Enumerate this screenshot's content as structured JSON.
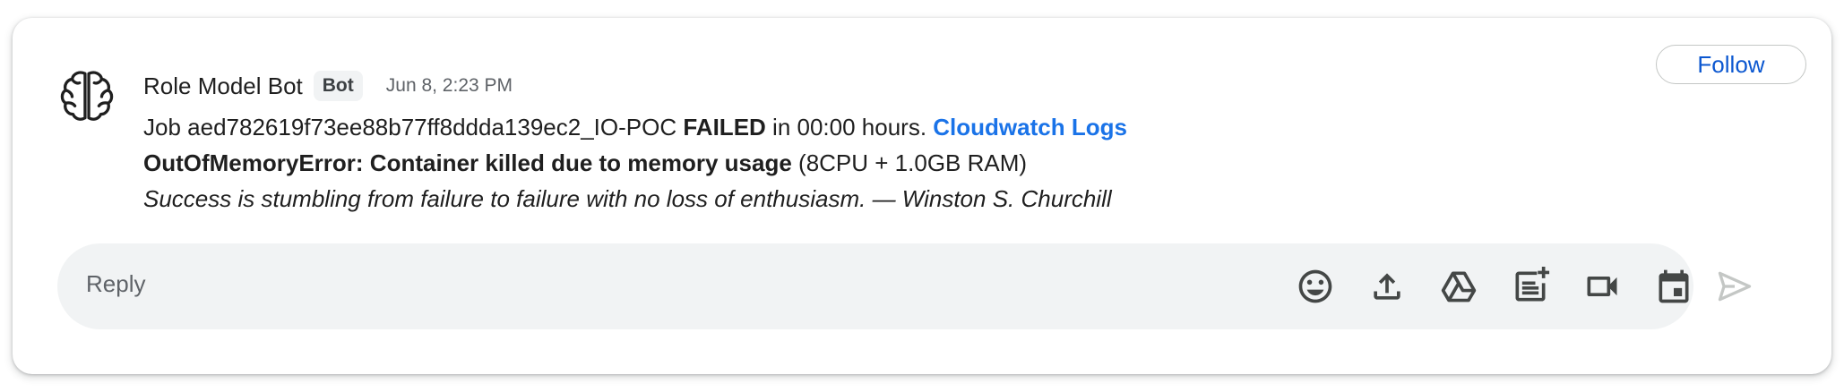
{
  "message": {
    "sender_name": "Role Model Bot",
    "badge": "Bot",
    "timestamp": "Jun 8, 2:23 PM",
    "follow_label": "Follow",
    "line1_prefix": "Job aed782619f73ee88b77ff8ddda139ec2_IO-POC ",
    "line1_status": "FAILED",
    "line1_suffix": " in 00:00 hours. ",
    "line1_link": "Cloudwatch Logs",
    "line2_error": "OutOfMemoryError: Container killed due to memory usage",
    "line2_resources": " (8CPU + 1.0GB RAM)",
    "quote": "Success is stumbling from failure to failure with no loss of enthusiasm. — Winston S. Churchill"
  },
  "reply": {
    "placeholder": "Reply",
    "tools": [
      "emoji-icon",
      "upload-icon",
      "drive-icon",
      "add-note-icon",
      "video-icon",
      "calendar-icon"
    ],
    "send_icon": "send-icon"
  },
  "colors": {
    "link": "#1a73e8",
    "follow": "#0b57d0",
    "reply_bg": "#f1f3f4",
    "icon": "#444746",
    "send_disabled": "#c4c7c5"
  }
}
